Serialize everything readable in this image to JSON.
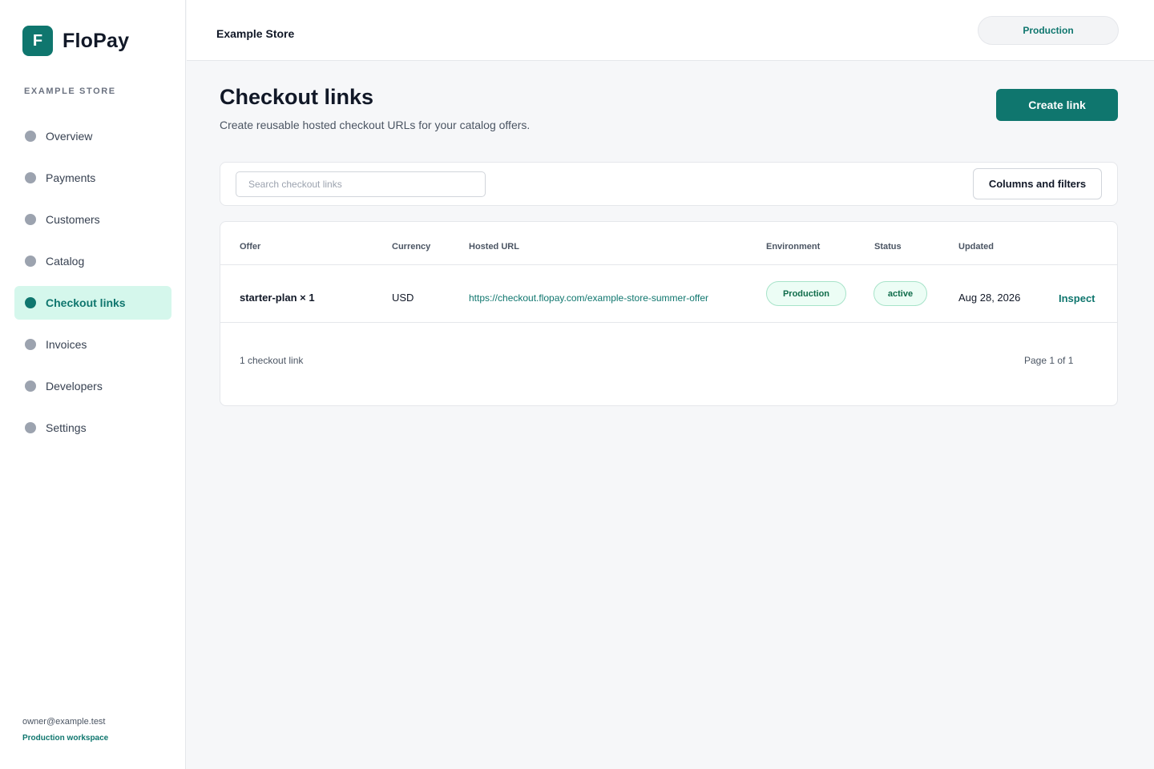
{
  "brand": {
    "logo_letter": "F",
    "name": "FloPay"
  },
  "sidebar": {
    "workspace_label": "EXAMPLE STORE",
    "items": [
      {
        "label": "Overview",
        "active": false
      },
      {
        "label": "Payments",
        "active": false
      },
      {
        "label": "Customers",
        "active": false
      },
      {
        "label": "Catalog",
        "active": false
      },
      {
        "label": "Checkout links",
        "active": true
      },
      {
        "label": "Invoices",
        "active": false
      },
      {
        "label": "Developers",
        "active": false
      },
      {
        "label": "Settings",
        "active": false
      }
    ],
    "footer": {
      "email": "owner@example.test",
      "workspace": "Production workspace"
    }
  },
  "header": {
    "store_name": "Example Store",
    "environment": "Production"
  },
  "main": {
    "title": "Checkout links",
    "subtitle": "Create reusable hosted checkout URLs for your catalog offers.",
    "create_button": "Create link",
    "search": {
      "placeholder": "Search checkout links",
      "value": ""
    },
    "filters_button": "Columns and filters",
    "table": {
      "columns": [
        "Offer",
        "Currency",
        "Hosted URL",
        "Environment",
        "Status",
        "Updated"
      ],
      "rows": [
        {
          "offer": "starter-plan × 1",
          "currency": "USD",
          "url": "https://checkout.flopay.com/example-store-summer-offer",
          "environment": "Production",
          "status": "active",
          "updated": "Aug 28, 2026",
          "action": "Inspect"
        }
      ],
      "count_text": "1 checkout link",
      "pagination": "Page 1 of 1"
    }
  },
  "colors": {
    "accent": "#0f766e",
    "active_nav_bg": "#d5f7ec",
    "badge_bg": "#ecfdf5",
    "page_bg": "#f6f7f9"
  }
}
